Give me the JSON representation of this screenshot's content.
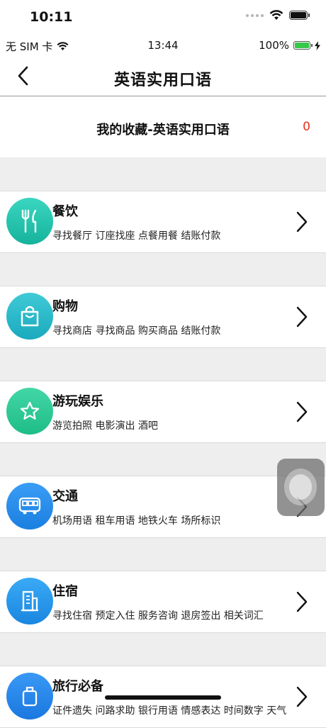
{
  "system_status": {
    "time": "10:11"
  },
  "inner_status": {
    "carrier": "无 SIM 卡",
    "time": "13:44",
    "battery": "100%"
  },
  "navbar": {
    "title": "英语实用口语"
  },
  "favorites": {
    "label": "我的收藏-英语实用口语",
    "count": "0"
  },
  "categories": [
    {
      "title": "餐饮",
      "subtitle": "寻找餐厅 订座找座 点餐用餐 结账付款",
      "icon": "fork-knife-icon",
      "color_top": "#3ad6c0",
      "color_bottom": "#16b39c"
    },
    {
      "title": "购物",
      "subtitle": "寻找商店 寻找商品 购买商品 结账付款",
      "icon": "shopping-bag-icon",
      "color_top": "#3fcad6",
      "color_bottom": "#1aa9be"
    },
    {
      "title": "游玩娱乐",
      "subtitle": "游览拍照 电影演出 酒吧",
      "icon": "star-icon",
      "color_top": "#43d6a7",
      "color_bottom": "#1ebd86"
    },
    {
      "title": "交通",
      "subtitle": "机场用语 租车用语 地铁火车 场所标识",
      "icon": "bus-icon",
      "color_top": "#3a9df5",
      "color_bottom": "#1b7fe0"
    },
    {
      "title": "住宿",
      "subtitle": "寻找住宿 预定入住 服务咨询 退房签出 相关词汇",
      "icon": "building-icon",
      "color_top": "#3aaaf5",
      "color_bottom": "#1a86e0"
    },
    {
      "title": "旅行必备",
      "subtitle": "证件遗失 问路求助 银行用语 情感表达 时间数字 天气",
      "icon": "suitcase-icon",
      "color_top": "#3a98f5",
      "color_bottom": "#1a78e0"
    }
  ]
}
